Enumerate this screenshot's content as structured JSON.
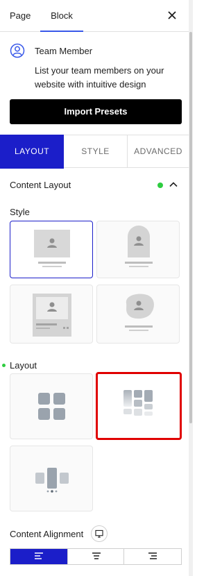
{
  "header": {
    "tabs": [
      "Page",
      "Block"
    ],
    "active_tab": "Block"
  },
  "block": {
    "title": "Team Member",
    "description": "List your team members on your website with intuitive design",
    "import_label": "Import Presets"
  },
  "subtabs": {
    "layout": "LAYOUT",
    "style": "STYLE",
    "advanced": "ADVANCED",
    "active": "LAYOUT"
  },
  "content_layout": {
    "heading": "Content Layout",
    "style_label": "Style",
    "layout_label": "Layout",
    "selected_style": 1,
    "highlighted_layout": 2
  },
  "alignment": {
    "label": "Content Alignment",
    "options": [
      "left-align-icon",
      "center-align-icon",
      "right-align-icon"
    ],
    "selected": "left-align-icon"
  },
  "colors": {
    "accent": "#1b1ec9",
    "tab_underline": "#3858e9",
    "status_dot": "#2ecc40",
    "highlight": "#e00000",
    "import_bg": "#000000"
  }
}
